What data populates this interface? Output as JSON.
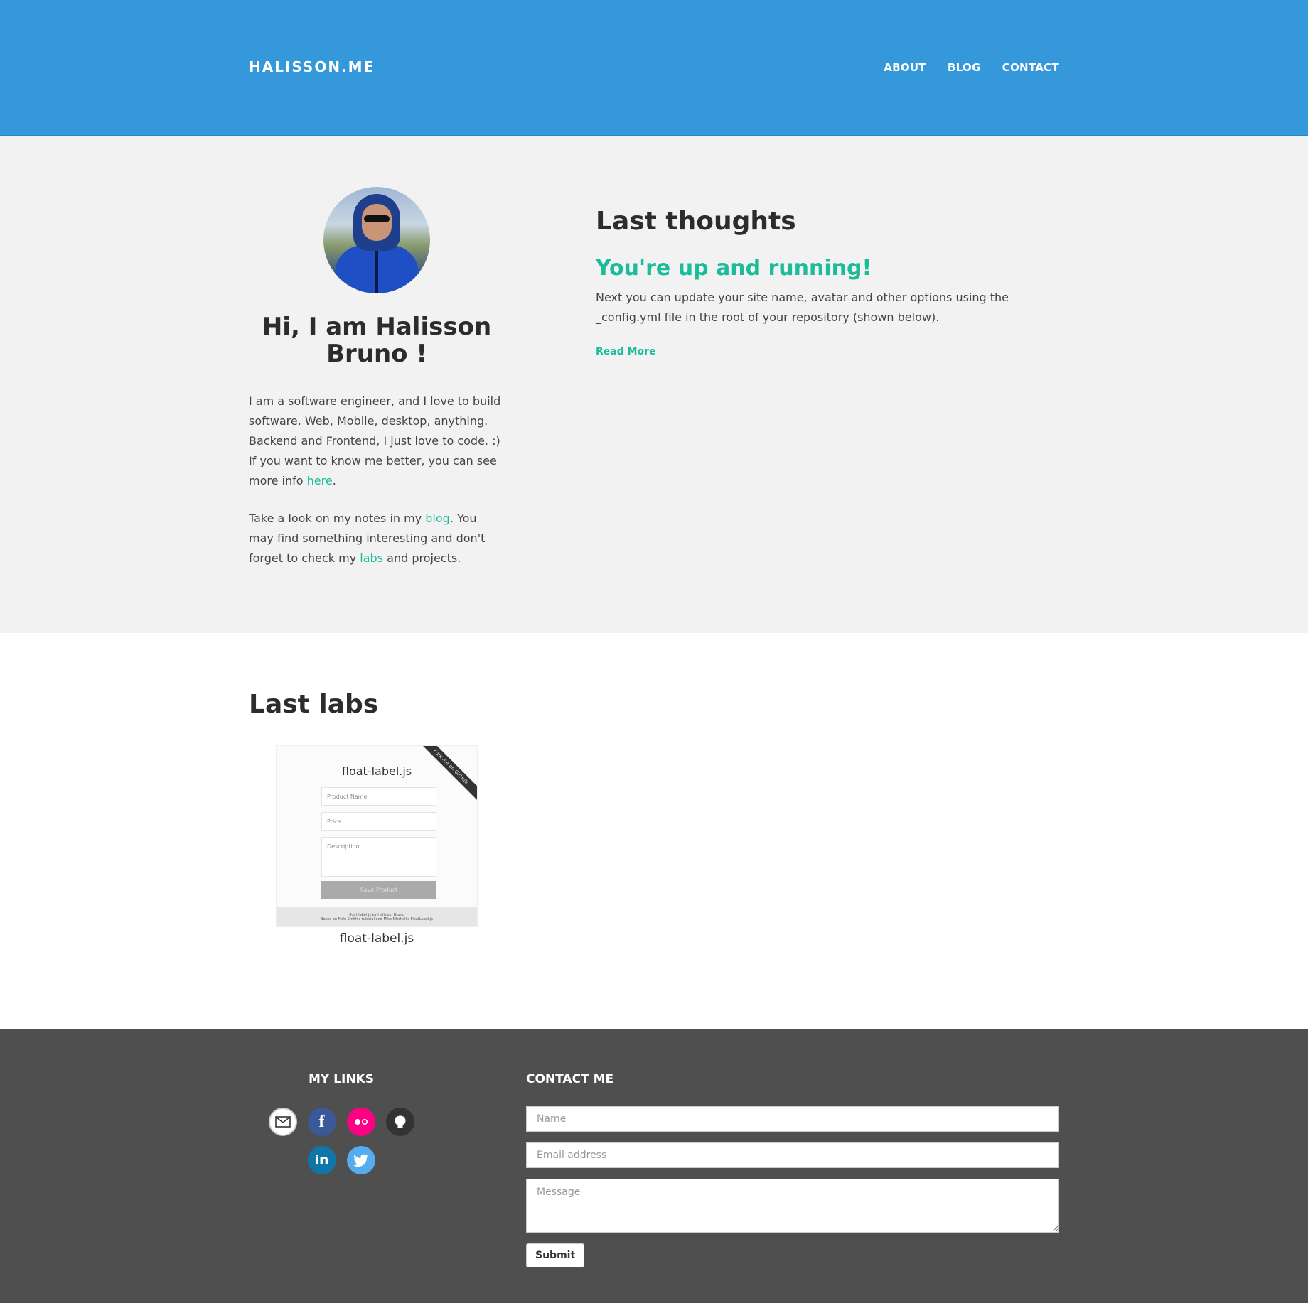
{
  "header": {
    "logo": "HALISSON.ME",
    "nav": [
      {
        "label": "ABOUT"
      },
      {
        "label": "BLOG"
      },
      {
        "label": "CONTACT"
      }
    ]
  },
  "profile": {
    "greeting": "Hi, I am Halisson Bruno !",
    "bio_p1_before": "I am a software engineer, and I love to build software. Web, Mobile, desktop, anything. Backend and Frontend, I just love to code. :) If you want to know me better, you can see more info ",
    "bio_p1_link": "here",
    "bio_p1_after": ".",
    "bio_p2_before": "Take a look on my notes in my ",
    "bio_p2_link1": "blog",
    "bio_p2_mid": ". You may find something interesting and don't forget to check my ",
    "bio_p2_link2": "labs",
    "bio_p2_after": " and projects."
  },
  "thoughts": {
    "heading": "Last thoughts",
    "post_title": "You're up and running!",
    "post_excerpt": "Next you can update your site name, avatar and other options using the _config.yml file in the root of your repository (shown below).",
    "read_more": "Read More"
  },
  "labs": {
    "heading": "Last labs",
    "items": [
      {
        "caption": "float-label.js",
        "thumb_title": "float-label.js",
        "thumb_fields": [
          "Product Name",
          "Price",
          "Description"
        ],
        "thumb_button": "Save Product",
        "ribbon": "Fork me on GitHub",
        "thumb_footer_line1": "float-label.js by Halisson Bruno",
        "thumb_footer_line2": "Based on Matt Smith's tutorial and Mike Mitchell's FloatLabel.js"
      }
    ]
  },
  "footer": {
    "links_heading": "MY LINKS",
    "icons": [
      "email-icon",
      "facebook-icon",
      "flickr-icon",
      "github-icon",
      "linkedin-icon",
      "twitter-icon"
    ],
    "contact_heading": "CONTACT ME",
    "name_placeholder": "Name",
    "email_placeholder": "Email address",
    "message_placeholder": "Message",
    "submit_label": "Submit"
  },
  "colors": {
    "header_bg": "#3498db",
    "accent": "#1abc9c",
    "hero_bg": "#f2f2f2",
    "footer_bg": "#4f4f4f"
  }
}
